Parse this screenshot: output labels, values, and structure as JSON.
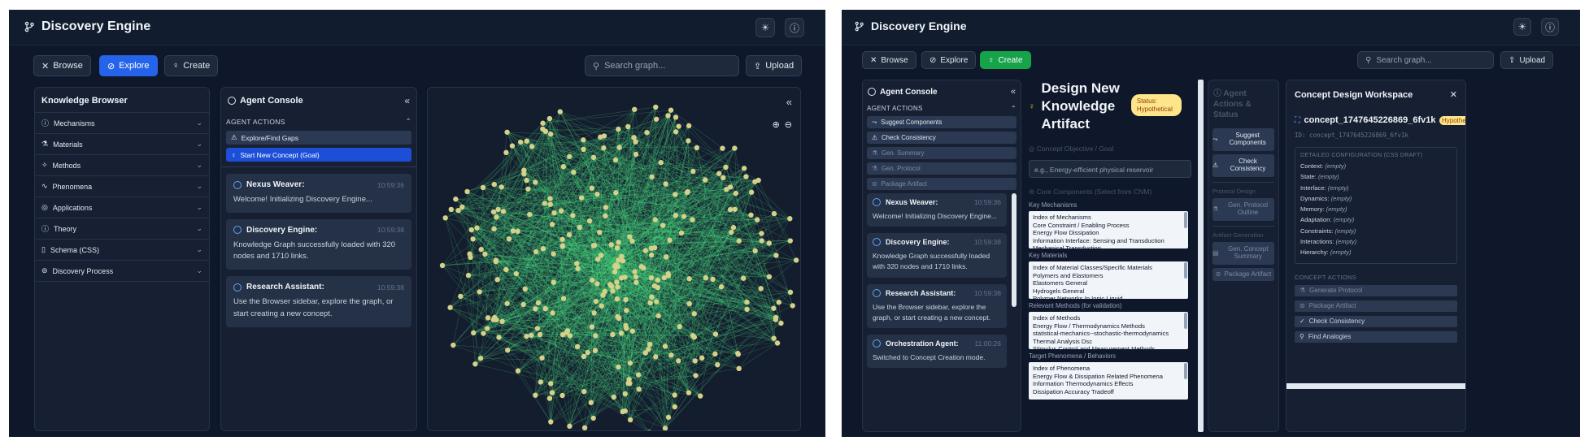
{
  "app": {
    "title": "Discovery Engine"
  },
  "toolbar": {
    "browse": "Browse",
    "explore": "Explore",
    "create": "Create",
    "search_placeholder": "Search graph...",
    "upload": "Upload"
  },
  "knowledge_browser": {
    "title": "Knowledge Browser",
    "items": [
      "Mechanisms",
      "Materials",
      "Methods",
      "Phenomena",
      "Applications",
      "Theory",
      "Schema (CSS)",
      "Discovery Process"
    ]
  },
  "agent_console": {
    "title": "Agent Console",
    "section": "AGENT ACTIONS",
    "actions_left": [
      "Explore/Find Gaps",
      "Start New Concept (Goal)"
    ],
    "actions_right": [
      "Suggest Components",
      "Check Consistency",
      "Gen. Summary",
      "Gen. Protocol",
      "Package Artifact"
    ],
    "messages": [
      {
        "who": "Nexus Weaver:",
        "time": "10:59:36",
        "text": "Welcome! Initializing Discovery Engine..."
      },
      {
        "who": "Discovery Engine:",
        "time": "10:59:38",
        "text": "Knowledge Graph successfully loaded with 320 nodes and 1710 links."
      },
      {
        "who": "Research Assistant:",
        "time": "10:59:38",
        "text": "Use the Browser sidebar, explore the graph, or start creating a new concept."
      },
      {
        "who": "Orchestration Agent:",
        "time": "11:00:26",
        "text": "Switched to Concept Creation mode."
      }
    ]
  },
  "design": {
    "title_lines": [
      "Design New",
      "Knowledge",
      "Artifact"
    ],
    "status": "Status: Hypothetical",
    "goal_label": "Concept Objective / Goal",
    "goal_placeholder": "e.g., Energy-efficient physical reservoir",
    "components_label": "Core Components (Select from CNM)",
    "groups": [
      {
        "label": "Key Mechanisms",
        "items": [
          "Index of Mechanisms",
          "Core Constraint / Enabling Process",
          "Energy Flow Dissipation",
          "Information Interface: Sensing and Transduction",
          "Mechanical Transduction"
        ]
      },
      {
        "label": "Key Materials",
        "items": [
          "Index of Material Classes/Specific Materials",
          "Polymers and Elastomers",
          "Elastomers General",
          "Hydrogels General",
          "Polymer Networks In Ionic Liquid"
        ]
      },
      {
        "label": "Relevant Methods (for validation)",
        "items": [
          "Index of Methods",
          "Energy Flow / Thermodynamics Methods",
          "statistical-mechanics--stochastic-thermodynamics",
          "Thermal Analysis Dsc",
          "Stimulus Control and Measurement Methods"
        ]
      },
      {
        "label": "Target Phenomena / Behaviors",
        "items": [
          "Index of Phenomena",
          "Energy Flow & Dissipation Related Phenomena",
          "Information Thermodynamics Effects",
          "Dissipation Accuracy Tradeoff"
        ]
      }
    ]
  },
  "status_panel": {
    "title": "Agent Actions & Status",
    "buttons_top": [
      "Suggest Components",
      "Check Consistency"
    ],
    "protocol_label": "Protocol Design",
    "protocol_btn": "Gen. Protocol Outline",
    "artifact_label": "Artifact Generation",
    "summary_btn": "Gen. Concept Summary",
    "package_btn": "Package Artifact"
  },
  "workspace": {
    "title": "Concept Design Workspace",
    "concept": "concept_1747645226869_6fv1k",
    "badge": "Hypothet",
    "id_line": "ID: concept_1747645226869_6fv1k",
    "config_title": "DETAILED CONFIGURATION (CSS DRAFT)",
    "fields": [
      {
        "k": "Context:",
        "v": "(empty)"
      },
      {
        "k": "State:",
        "v": "(empty)"
      },
      {
        "k": "Interface:",
        "v": "(empty)"
      },
      {
        "k": "Dynamics:",
        "v": "(empty)"
      },
      {
        "k": "Memory:",
        "v": "(empty)"
      },
      {
        "k": "Adaptation:",
        "v": "(empty)"
      },
      {
        "k": "Constraints:",
        "v": "(empty)"
      },
      {
        "k": "Interactions:",
        "v": "(empty)"
      },
      {
        "k": "Hierarchy:",
        "v": "(empty)"
      }
    ],
    "actions_title": "CONCEPT ACTIONS",
    "actions": [
      "Generate Protocol",
      "Package Artifact",
      "Check Consistency",
      "Find Analogies"
    ]
  },
  "graph": {
    "nodes": 320,
    "links": 1710,
    "node_color": "#d6d18a",
    "link_color": "#4ade80"
  },
  "colors": {
    "bg": "#0f172a",
    "panel": "#172033",
    "accent_blue": "#2563eb",
    "accent_green": "#16a34a",
    "badge": "#fde68a"
  }
}
